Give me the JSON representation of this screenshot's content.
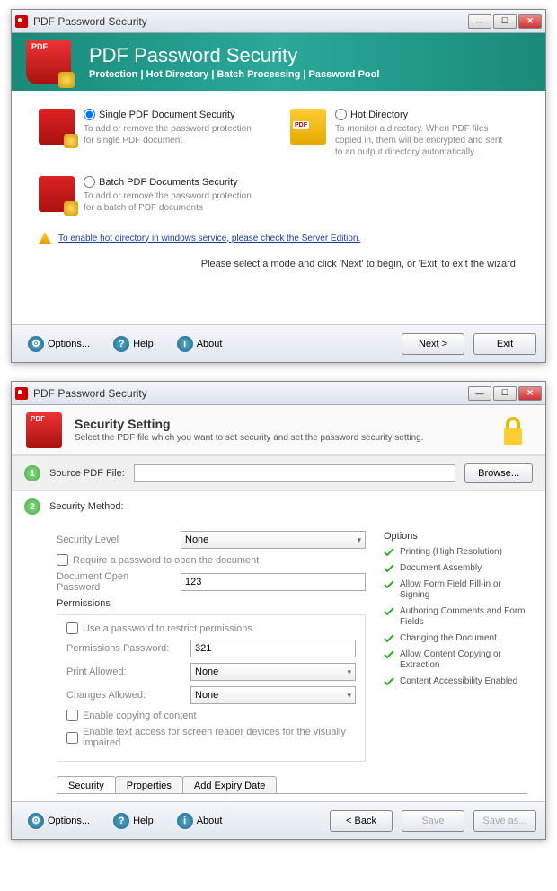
{
  "window1": {
    "title": "PDF Password Security",
    "banner": {
      "title": "PDF Password Security",
      "subtitle": "Protection | Hot Directory | Batch Processing | Password Pool"
    },
    "modes": {
      "single": {
        "label": "Single PDF Document Security",
        "desc": "To add or remove the password protection for single PDF document"
      },
      "hot": {
        "label": "Hot Directory",
        "desc": "To monitor a directory. When PDF files copied in, them will be encrypted and sent to an output directory automatically."
      },
      "batch": {
        "label": "Batch PDF Documents Security",
        "desc": "To add or remove the password protection for a batch of PDF documents"
      }
    },
    "warn_link": "To enable hot directory in windows service, please check the Server Edition.",
    "instruction": "Please select a mode and click 'Next' to begin, or 'Exit' to exit the wizard.",
    "footer": {
      "options": "Options...",
      "help": "Help",
      "about": "About",
      "next": "Next >",
      "exit": "Exit"
    }
  },
  "window2": {
    "title": "PDF Password Security",
    "header": {
      "title": "Security Setting",
      "sub": "Select the PDF file which you want to set security and set the password security setting."
    },
    "step1": {
      "label": "Source PDF File:",
      "browse": "Browse..."
    },
    "step2": {
      "label": "Security Method:"
    },
    "fields": {
      "level_label": "Security Level",
      "level_value": "None",
      "require_open": "Require a password to open the document",
      "open_pw_label": "Document Open Password",
      "open_pw_value": "123",
      "perms_head": "Permissions",
      "use_perm": "Use a password to restrict permissions",
      "perm_pw_label": "Permissions Password:",
      "perm_pw_value": "321",
      "print_label": "Print Allowed:",
      "print_value": "None",
      "changes_label": "Changes Allowed:",
      "changes_value": "None",
      "copy": "Enable copying of content",
      "access": "Enable text access for screen reader devices for the visually impaired"
    },
    "options": {
      "head": "Options",
      "items": [
        "Printing (High Resolution)",
        "Document Assembly",
        "Allow Form Field Fill-in or Signing",
        "Authoring Comments and Form Fields",
        "Changing the Document",
        "Allow Content Copying or Extraction",
        "Content Accessibility Enabled"
      ]
    },
    "tabs": {
      "security": "Security",
      "properties": "Properties",
      "expiry": "Add Expiry Date"
    },
    "footer": {
      "options": "Options...",
      "help": "Help",
      "about": "About",
      "back": "< Back",
      "save": "Save",
      "saveas": "Save as..."
    }
  }
}
